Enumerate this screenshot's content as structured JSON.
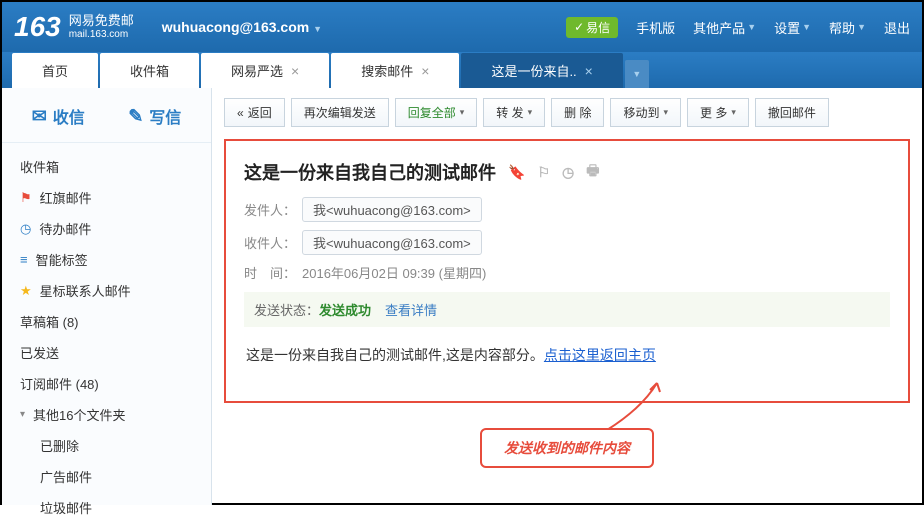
{
  "header": {
    "logo_num": "163",
    "logo_text": "网易免费邮",
    "logo_sub": "mail.163.com",
    "user_email": "wuhuacong@163.com",
    "nav": {
      "yixin": "易信",
      "mobile": "手机版",
      "products": "其他产品",
      "settings": "设置",
      "help": "帮助",
      "logout": "退出"
    }
  },
  "tabs": {
    "home": "首页",
    "inbox": "收件箱",
    "yanxuan": "网易严选",
    "search": "搜索邮件",
    "current": "这是一份来自.."
  },
  "sidebar": {
    "receive": "收信",
    "compose": "写信",
    "folders": {
      "inbox": "收件箱",
      "flag": "红旗邮件",
      "todo": "待办邮件",
      "smart": "智能标签",
      "star": "星标联系人邮件",
      "draft": "草稿箱 (8)",
      "sent": "已发送",
      "subscribe": "订阅邮件 (48)",
      "other": "其他16个文件夹",
      "deleted": "已删除",
      "ad": "广告邮件",
      "spam": "垃圾邮件"
    }
  },
  "toolbar": {
    "back": "返回",
    "reedit": "再次编辑发送",
    "replyall": "回复全部",
    "forward": "转 发",
    "delete": "删 除",
    "moveto": "移动到",
    "more": "更 多",
    "recall": "撤回邮件"
  },
  "mail": {
    "subject": "这是一份来自我自己的测试邮件",
    "from_label": "发件人：",
    "from_addr": "我<wuhuacong@163.com>",
    "to_label": "收件人：",
    "to_addr": "我<wuhuacong@163.com>",
    "time_label": "时　间：",
    "time_value": "2016年06月02日 09:39 (星期四)",
    "status_label": "发送状态：",
    "status_value": "发送成功",
    "status_detail": "查看详情",
    "body_text": "这是一份来自我自己的测试邮件,这是内容部分。",
    "body_link": "点击这里返回主页"
  },
  "annotation": "发送收到的邮件内容"
}
